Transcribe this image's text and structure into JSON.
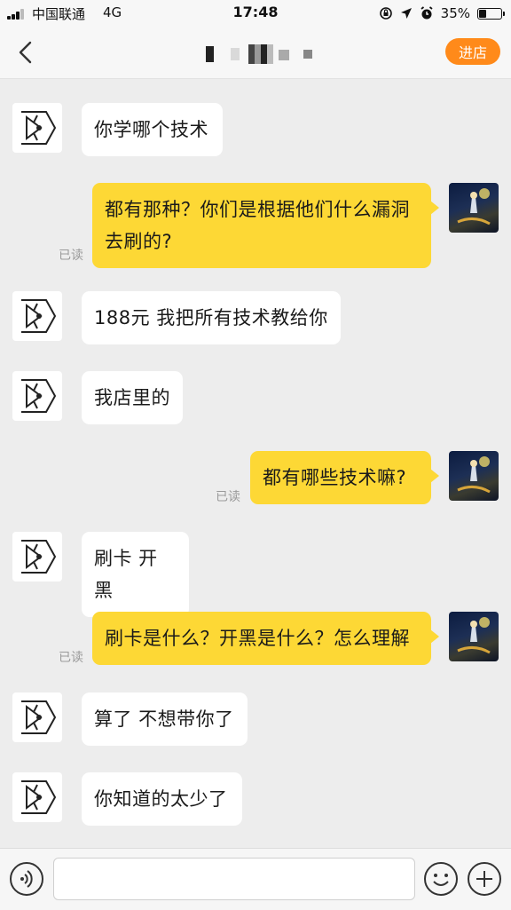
{
  "status_bar": {
    "carrier": "中国联通",
    "network": "4G",
    "time": "17:48",
    "battery": "35%",
    "battery_level": 0.35
  },
  "header": {
    "shop_button": "进店"
  },
  "messages": [
    {
      "from": "shop",
      "text": "你学哪个技术"
    },
    {
      "from": "me",
      "text": "都有那种？你们是根据他们什么漏洞去刷的?",
      "status": "已读"
    },
    {
      "from": "shop",
      "text": "188元 我把所有技术教给你"
    },
    {
      "from": "shop",
      "text": "我店里的"
    },
    {
      "from": "me",
      "text": "都有哪些技术嘛?",
      "status": "已读"
    },
    {
      "from": "shop",
      "text": "刷卡 开黑"
    },
    {
      "from": "me",
      "text": "刷卡是什么？开黑是什么？怎么理解",
      "status": "已读"
    },
    {
      "from": "shop",
      "text": "算了 不想带你了"
    },
    {
      "from": "shop",
      "text": "你知道的太少了"
    }
  ],
  "input": {
    "value": "",
    "placeholder": ""
  },
  "icons": {
    "back": "chevron-left-icon",
    "voice": "voice-icon",
    "emoji": "emoji-icon",
    "add": "plus-icon"
  },
  "colors": {
    "accent": "#ff8a1a",
    "outgoing_bubble": "#fdd835",
    "incoming_bubble": "#ffffff",
    "background": "#ededed"
  }
}
